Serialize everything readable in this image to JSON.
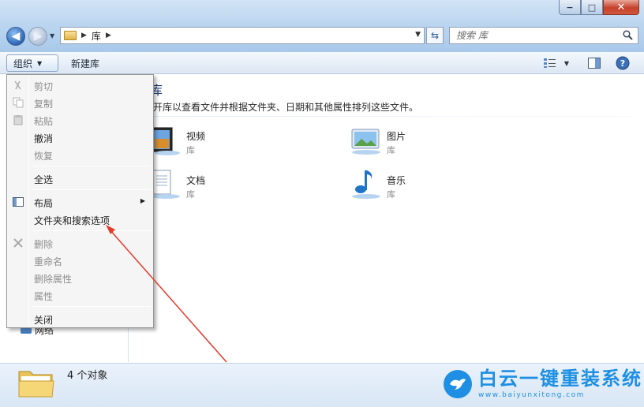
{
  "window": {
    "buttons": {
      "minimize": "−",
      "maximize": "□",
      "close": "✕"
    }
  },
  "nav": {
    "back_glyph": "◀",
    "forward_glyph": "▶",
    "recent_glyph": "▼"
  },
  "address": {
    "separator": "▶",
    "crumb": "库",
    "dropdown_glyph": "▼",
    "refresh_glyph": "⇆"
  },
  "search": {
    "placeholder": "搜索 库",
    "icon": "search-icon"
  },
  "toolbar": {
    "organize_label": "组织",
    "organize_arrow": "▼",
    "new_library_label": "新建库",
    "views_arrow": "▼",
    "help_glyph": "?"
  },
  "main": {
    "header_fragment": "库",
    "description": "开库以查看文件并根据文件夹、日期和其他属性排列这些文件。",
    "libraries": [
      {
        "name": "视频",
        "type": "库",
        "icon": "video-library-icon"
      },
      {
        "name": "图片",
        "type": "库",
        "icon": "pictures-library-icon"
      },
      {
        "name": "文档",
        "type": "库",
        "icon": "documents-library-icon"
      },
      {
        "name": "音乐",
        "type": "库",
        "icon": "music-library-icon"
      }
    ]
  },
  "navpane": {
    "partial_item": "网络"
  },
  "menu": {
    "items": [
      {
        "label": "剪切",
        "enabled": false,
        "icon": "scissors-icon"
      },
      {
        "label": "复制",
        "enabled": false,
        "icon": "copy-icon"
      },
      {
        "label": "粘贴",
        "enabled": false,
        "icon": "paste-icon"
      },
      {
        "label": "撤消",
        "enabled": true
      },
      {
        "label": "恢复",
        "enabled": false
      },
      {
        "label": "全选",
        "enabled": true
      },
      {
        "label": "布局",
        "enabled": true,
        "icon": "layout-icon",
        "submenu": true
      },
      {
        "label": "文件夹和搜索选项",
        "enabled": true
      },
      {
        "label": "删除",
        "enabled": false,
        "icon": "delete-icon"
      },
      {
        "label": "重命名",
        "enabled": false
      },
      {
        "label": "删除属性",
        "enabled": false
      },
      {
        "label": "属性",
        "enabled": false
      },
      {
        "label": "关闭",
        "enabled": true
      }
    ],
    "submenu_glyph": "▶"
  },
  "status": {
    "text": "4 个对象"
  },
  "watermark": {
    "title": "白云一键重装系统",
    "url": "www.baiyunxitong.com"
  },
  "colors": {
    "annotation_arrow": "#e53b2c",
    "watermark_blue": "#1e8fe3"
  }
}
